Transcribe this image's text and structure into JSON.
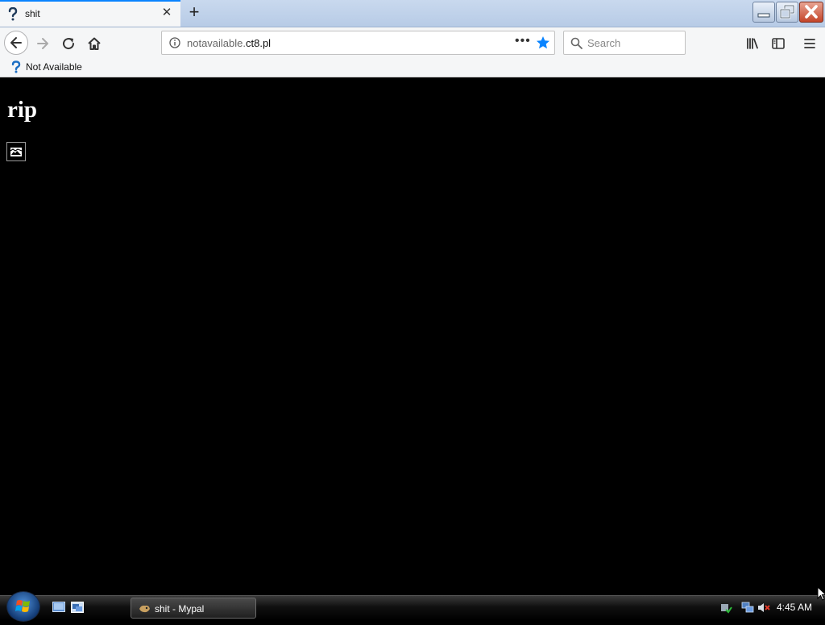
{
  "tab": {
    "title": "shit",
    "favicon": "question-mark-icon"
  },
  "urlbar": {
    "prefix": "notavailable.",
    "host": "ct8.pl",
    "page_actions": "•••"
  },
  "search": {
    "placeholder": "Search"
  },
  "bookmarks": [
    {
      "label": "Not Available",
      "icon": "question-mark-icon"
    }
  ],
  "page": {
    "heading": "rip",
    "image": "broken-image-icon",
    "background": "#000000"
  },
  "taskbar": {
    "task_label": "shit - Mypal",
    "clock": "4:45 AM"
  },
  "colors": {
    "accent": "#0a84ff",
    "close_button": "#c4452a"
  }
}
